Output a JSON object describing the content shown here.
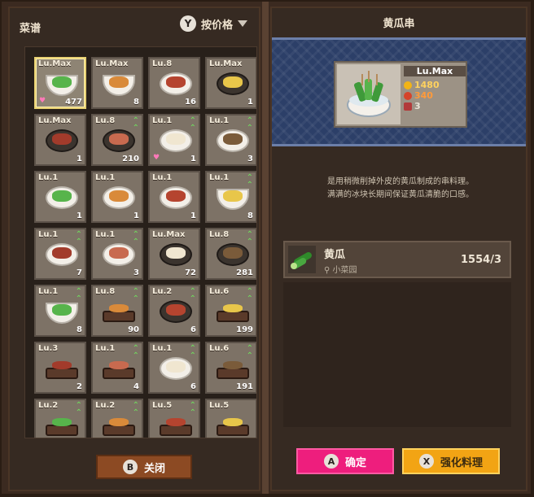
{
  "left_panel": {
    "title": "菜谱",
    "sort_button_key": "Y",
    "sort_label": "按价格",
    "close_key": "B",
    "close_label": "关闭"
  },
  "recipes": [
    {
      "level": "Lu.Max",
      "count": "477",
      "upgrade": false,
      "fav": true,
      "selected": true,
      "dish": "cucumber-skewer-bowl"
    },
    {
      "level": "Lu.Max",
      "count": "8",
      "upgrade": false,
      "fav": false,
      "dish": "noodle-bowl"
    },
    {
      "level": "Lu.8",
      "count": "16",
      "upgrade": false,
      "fav": false,
      "dish": "meat-plate"
    },
    {
      "level": "Lu.Max",
      "count": "1",
      "upgrade": false,
      "fav": false,
      "dish": "stew-pot"
    },
    {
      "level": "Lu.Max",
      "count": "1",
      "upgrade": false,
      "fav": false,
      "dish": "fried-plate"
    },
    {
      "level": "Lu.8",
      "count": "210",
      "upgrade": true,
      "fav": false,
      "dish": "steak-plate"
    },
    {
      "level": "Lu.1",
      "count": "1",
      "upgrade": true,
      "fav": true,
      "dish": "shrimp-salad"
    },
    {
      "level": "Lu.1",
      "count": "3",
      "upgrade": true,
      "fav": false,
      "dish": "onion-rings"
    },
    {
      "level": "Lu.1",
      "count": "1",
      "upgrade": false,
      "fav": false,
      "dish": "fish-plate"
    },
    {
      "level": "Lu.1",
      "count": "1",
      "upgrade": false,
      "fav": false,
      "dish": "sardine-box"
    },
    {
      "level": "Lu.1",
      "count": "1",
      "upgrade": false,
      "fav": false,
      "dish": "crab-plate"
    },
    {
      "level": "Lu.1",
      "count": "8",
      "upgrade": true,
      "fav": false,
      "dish": "orange-bowl"
    },
    {
      "level": "Lu.1",
      "count": "7",
      "upgrade": true,
      "fav": false,
      "dish": "curry-plate"
    },
    {
      "level": "Lu.1",
      "count": "3",
      "upgrade": true,
      "fav": false,
      "dish": "tofu-plate"
    },
    {
      "level": "Lu.Max",
      "count": "72",
      "upgrade": false,
      "fav": false,
      "dish": "tuna-plate"
    },
    {
      "level": "Lu.8",
      "count": "281",
      "upgrade": true,
      "fav": false,
      "dish": "beef-plate"
    },
    {
      "level": "Lu.1",
      "count": "8",
      "upgrade": true,
      "fav": false,
      "dish": "poke-bowl"
    },
    {
      "level": "Lu.8",
      "count": "90",
      "upgrade": true,
      "fav": false,
      "dish": "fish-board"
    },
    {
      "level": "Lu.2",
      "count": "6",
      "upgrade": true,
      "fav": false,
      "dish": "greens-plate"
    },
    {
      "level": "Lu.6",
      "count": "199",
      "upgrade": true,
      "fav": false,
      "dish": "sushi-board"
    },
    {
      "level": "Lu.3",
      "count": "2",
      "upgrade": false,
      "fav": false,
      "dish": "nigiri-board"
    },
    {
      "level": "Lu.1",
      "count": "4",
      "upgrade": true,
      "fav": false,
      "dish": "maki-platter"
    },
    {
      "level": "Lu.1",
      "count": "6",
      "upgrade": true,
      "fav": false,
      "dish": "tempura-plate"
    },
    {
      "level": "Lu.6",
      "count": "191",
      "upgrade": true,
      "fav": false,
      "dish": "salmon-board"
    },
    {
      "level": "Lu.2",
      "count": "",
      "upgrade": true,
      "fav": false,
      "dish": "sushi-board-2"
    },
    {
      "level": "Lu.2",
      "count": "",
      "upgrade": true,
      "fav": false,
      "dish": "sushi-board-3"
    },
    {
      "level": "Lu.5",
      "count": "",
      "upgrade": true,
      "fav": false,
      "dish": "grilled-fish-board"
    },
    {
      "level": "Lu.5",
      "count": "",
      "upgrade": false,
      "fav": false,
      "dish": "egg-sushi-board"
    }
  ],
  "detail": {
    "title": "黄瓜串",
    "level": "Lu.Max",
    "price": "1480",
    "satisfaction": "340",
    "servings": "3",
    "description_line1": "是用稍微削掉外皮的黄瓜制成的串料理。",
    "description_line2": "满满的冰块长期间保证黄瓜清脆的口感。",
    "ingredient": {
      "name": "黄瓜",
      "location": "小菜园",
      "count": "1554/3"
    }
  },
  "actions": {
    "confirm_key": "A",
    "confirm_label": "确定",
    "enhance_key": "X",
    "enhance_label": "强化料理"
  },
  "colors": {
    "confirm": "#ee1e7d",
    "enhance": "#f2a414",
    "close": "#8c4a23",
    "upgrade_arrow": "#6fe25e",
    "detail_band": "#2c3f68"
  }
}
